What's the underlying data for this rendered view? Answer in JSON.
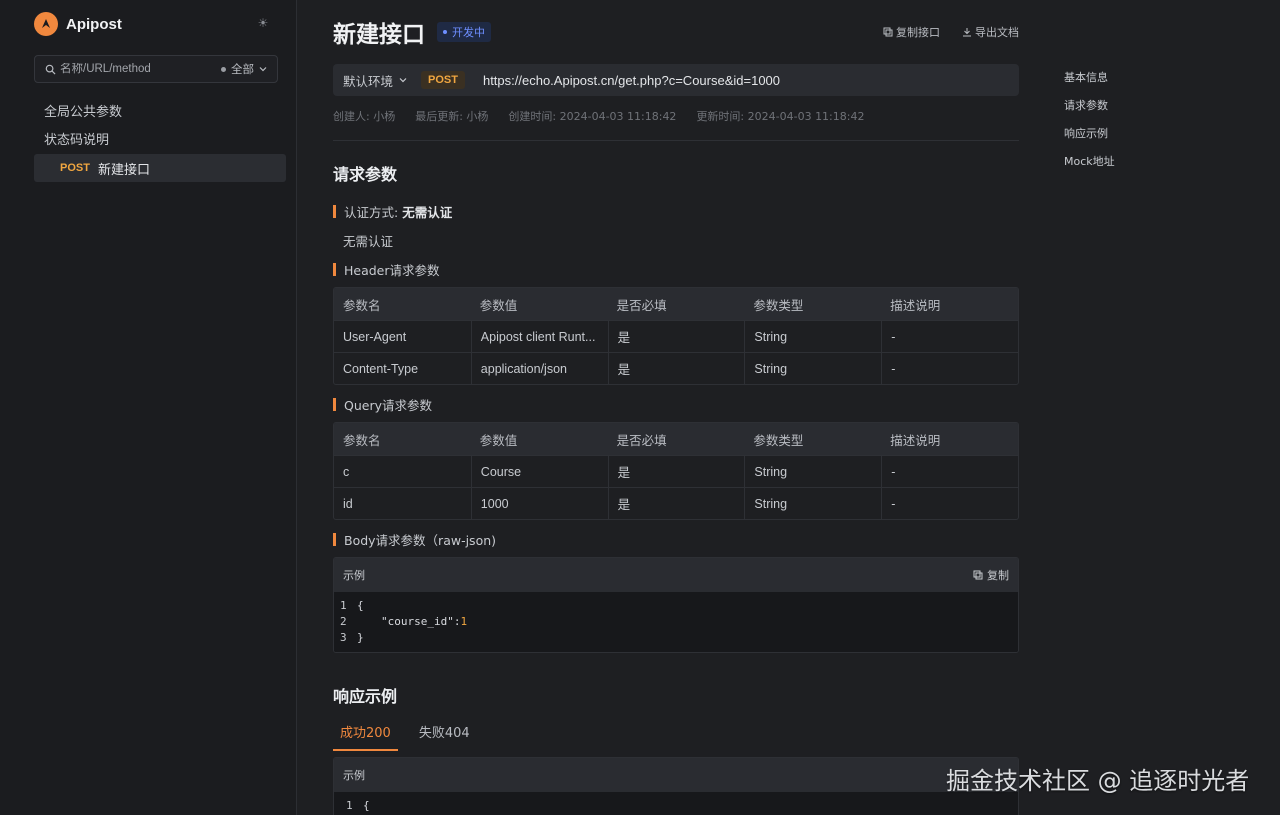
{
  "app": {
    "name": "Apipost"
  },
  "sidebar": {
    "search_placeholder": "名称/URL/method",
    "filter_label": "全部",
    "items": [
      {
        "label": "全局公共参数"
      },
      {
        "label": "状态码说明"
      }
    ],
    "api_item": {
      "method": "POST",
      "label": "新建接口"
    }
  },
  "header": {
    "title": "新建接口",
    "status": "开发中",
    "copy_api": "复制接口",
    "export_doc": "导出文档"
  },
  "url_bar": {
    "env": "默认环境",
    "method": "POST",
    "url": "https://echo.Apipost.cn/get.php?c=Course&id=1000"
  },
  "meta": {
    "creator": "创建人: 小杨",
    "updater": "最后更新: 小杨",
    "created": "创建时间: 2024-04-03 11:18:42",
    "updated": "更新时间: 2024-04-03 11:18:42"
  },
  "request": {
    "title": "请求参数",
    "auth_label": "认证方式:",
    "auth_value": "无需认证",
    "auth_desc": "无需认证",
    "header_title": "Header请求参数",
    "query_title": "Query请求参数",
    "body_title": "Body请求参数（raw-json)",
    "columns": [
      "参数名",
      "参数值",
      "是否必填",
      "参数类型",
      "描述说明"
    ],
    "header_rows": [
      [
        "User-Agent",
        "Apipost client Runt...",
        "是",
        "String",
        "-"
      ],
      [
        "Content-Type",
        "application/json",
        "是",
        "String",
        "-"
      ]
    ],
    "query_rows": [
      [
        "c",
        "Course",
        "是",
        "String",
        "-"
      ],
      [
        "id",
        "1000",
        "是",
        "String",
        "-"
      ]
    ],
    "example_label": "示例",
    "copy_label": "复制",
    "code": {
      "line1": "{",
      "line2_key": "\"course_id\":",
      "line2_val": "1",
      "line3": "}"
    }
  },
  "response": {
    "title": "响应示例",
    "tabs": [
      "成功200",
      "失败404"
    ],
    "example_label": "示例",
    "code_line1": "{"
  },
  "outline": [
    "基本信息",
    "请求参数",
    "响应示例",
    "Mock地址"
  ],
  "watermark": "掘金技术社区 @ 追逐时光者",
  "colors": {
    "accent": "#f0883e",
    "post": "#f0a640",
    "status": "#6e8fff"
  }
}
